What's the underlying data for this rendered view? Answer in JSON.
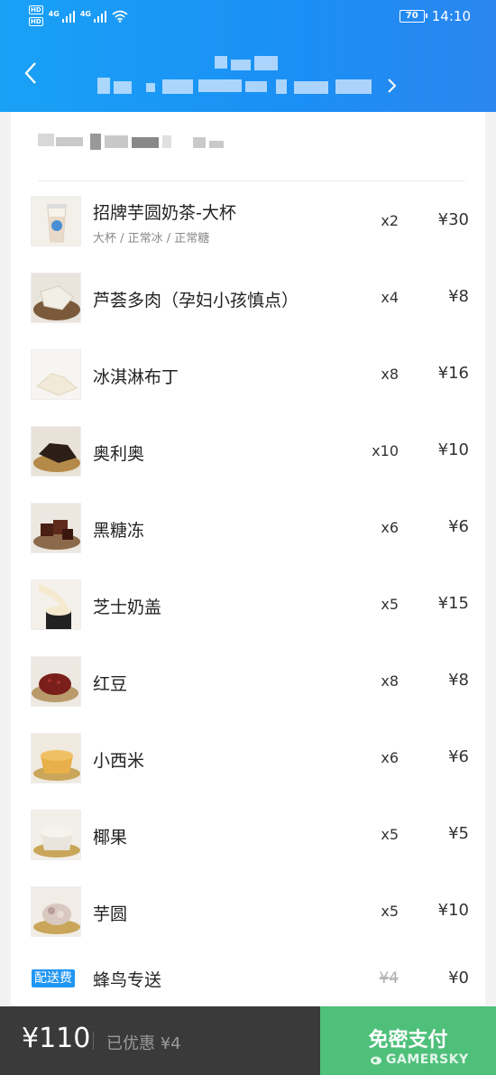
{
  "status_bar": {
    "hd_label": "HD",
    "network": "4G",
    "battery": "70",
    "time": "14:10"
  },
  "header": {
    "back_icon": "chevron-left-icon"
  },
  "items": [
    {
      "name": "招牌芋圆奶茶-大杯",
      "spec": "大杯 / 正常冰 / 正常糖",
      "qty": "x2",
      "price": "¥30",
      "icon": "milk-tea-icon"
    },
    {
      "name": "芦荟多肉（孕妇小孩慎点）",
      "qty": "x4",
      "price": "¥8",
      "icon": "aloe-icon"
    },
    {
      "name": "冰淇淋布丁",
      "qty": "x8",
      "price": "¥16",
      "icon": "pudding-icon"
    },
    {
      "name": "奥利奥",
      "qty": "x10",
      "price": "¥10",
      "icon": "oreo-icon"
    },
    {
      "name": "黑糖冻",
      "qty": "x6",
      "price": "¥6",
      "icon": "brown-sugar-jelly-icon"
    },
    {
      "name": "芝士奶盖",
      "qty": "x5",
      "price": "¥15",
      "icon": "cheese-foam-icon"
    },
    {
      "name": "红豆",
      "qty": "x8",
      "price": "¥8",
      "icon": "red-bean-icon"
    },
    {
      "name": "小西米",
      "qty": "x6",
      "price": "¥6",
      "icon": "sago-icon"
    },
    {
      "name": "椰果",
      "qty": "x5",
      "price": "¥5",
      "icon": "coconut-jelly-icon"
    },
    {
      "name": "芋圆",
      "qty": "x5",
      "price": "¥10",
      "icon": "taro-ball-icon"
    }
  ],
  "delivery": {
    "badge": "配送费",
    "name": "蜂鸟专送",
    "original_price": "¥4",
    "price": "¥0"
  },
  "footer": {
    "total": "¥110",
    "discount": "已优惠 ¥4",
    "pay_button": "免密支付"
  },
  "watermark": "GAMERSKY",
  "colors": {
    "header_blue": "#1a8ff5",
    "pay_green": "#4fc07a",
    "bottom_bar": "#3a3a3a",
    "badge_blue": "#2196f3"
  }
}
